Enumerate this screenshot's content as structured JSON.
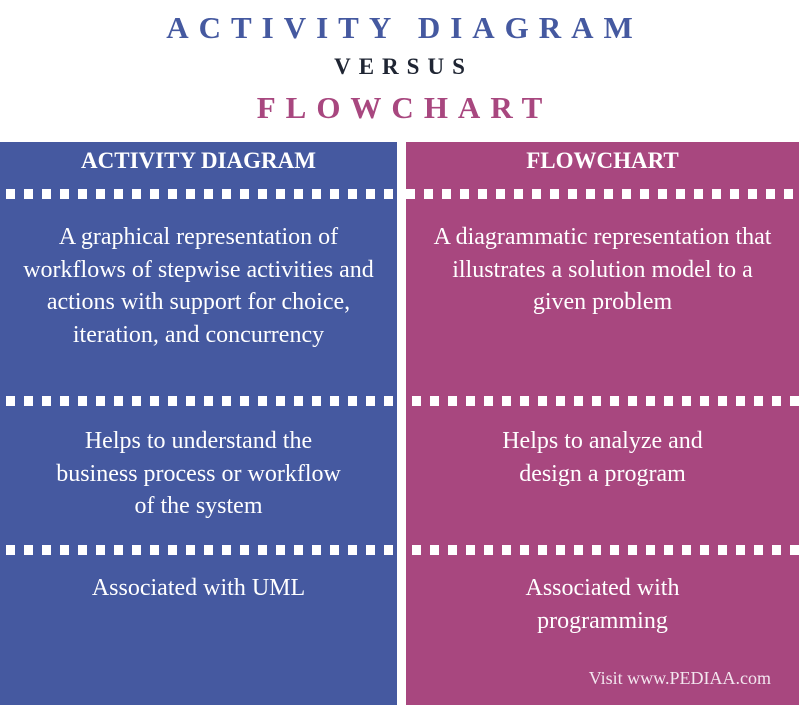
{
  "title": {
    "line1": "ACTIVITY DIAGRAM",
    "line2": "VERSUS",
    "line3": "FLOWCHART"
  },
  "colors": {
    "left_column": "#4559a0",
    "right_column": "#a8477f",
    "versus_text": "#1f2533",
    "background": "#ffffff"
  },
  "columns": [
    {
      "header": "ACTIVITY DIAGRAM",
      "rows": [
        "A graphical representation of workflows of stepwise activities and actions with support for choice, iteration, and concurrency",
        "Helps to understand the business process or workflow of the system",
        "Associated with UML"
      ]
    },
    {
      "header": "FLOWCHART",
      "rows": [
        "A diagrammatic representation that illustrates a solution model to a given problem",
        "Helps to analyze and design a program",
        "Associated with programming"
      ]
    }
  ],
  "credit": "Visit www.PEDIAA.com"
}
